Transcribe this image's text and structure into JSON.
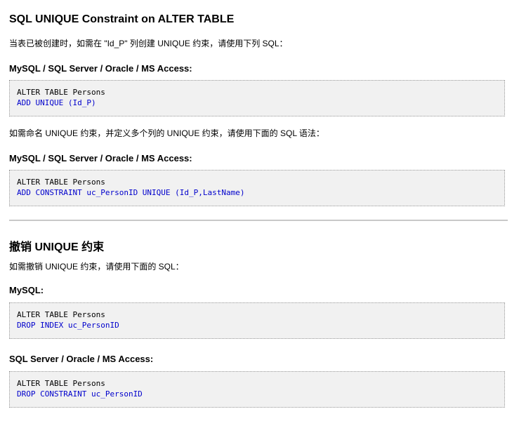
{
  "section1": {
    "title": "SQL UNIQUE Constraint on ALTER TABLE",
    "intro": "当表已被创建时，如需在 \"Id_P\" 列创建 UNIQUE 约束，请使用下列 SQL：",
    "heading1": "MySQL / SQL Server / Oracle / MS Access:",
    "code1": [
      "ALTER TABLE Persons",
      "ADD UNIQUE (Id_P)"
    ],
    "intro2": "如需命名 UNIQUE 约束，并定义多个列的 UNIQUE 约束，请使用下面的 SQL 语法：",
    "heading2": "MySQL / SQL Server / Oracle / MS Access:",
    "code2": [
      "ALTER TABLE Persons",
      "ADD CONSTRAINT uc_PersonID UNIQUE (Id_P,LastName)"
    ]
  },
  "section2": {
    "title": "撤销 UNIQUE 约束",
    "intro": "如需撤销 UNIQUE 约束，请使用下面的 SQL：",
    "heading1": "MySQL:",
    "code1": [
      "ALTER TABLE Persons",
      "DROP INDEX uc_PersonID"
    ],
    "heading2": "SQL Server / Oracle / MS Access:",
    "code2": [
      "ALTER TABLE Persons",
      "DROP CONSTRAINT uc_PersonID"
    ]
  },
  "colors": {
    "code_keyword_blue": "#0000cc",
    "code_background": "#f1f1f1",
    "divider": "#c8c8c8"
  }
}
